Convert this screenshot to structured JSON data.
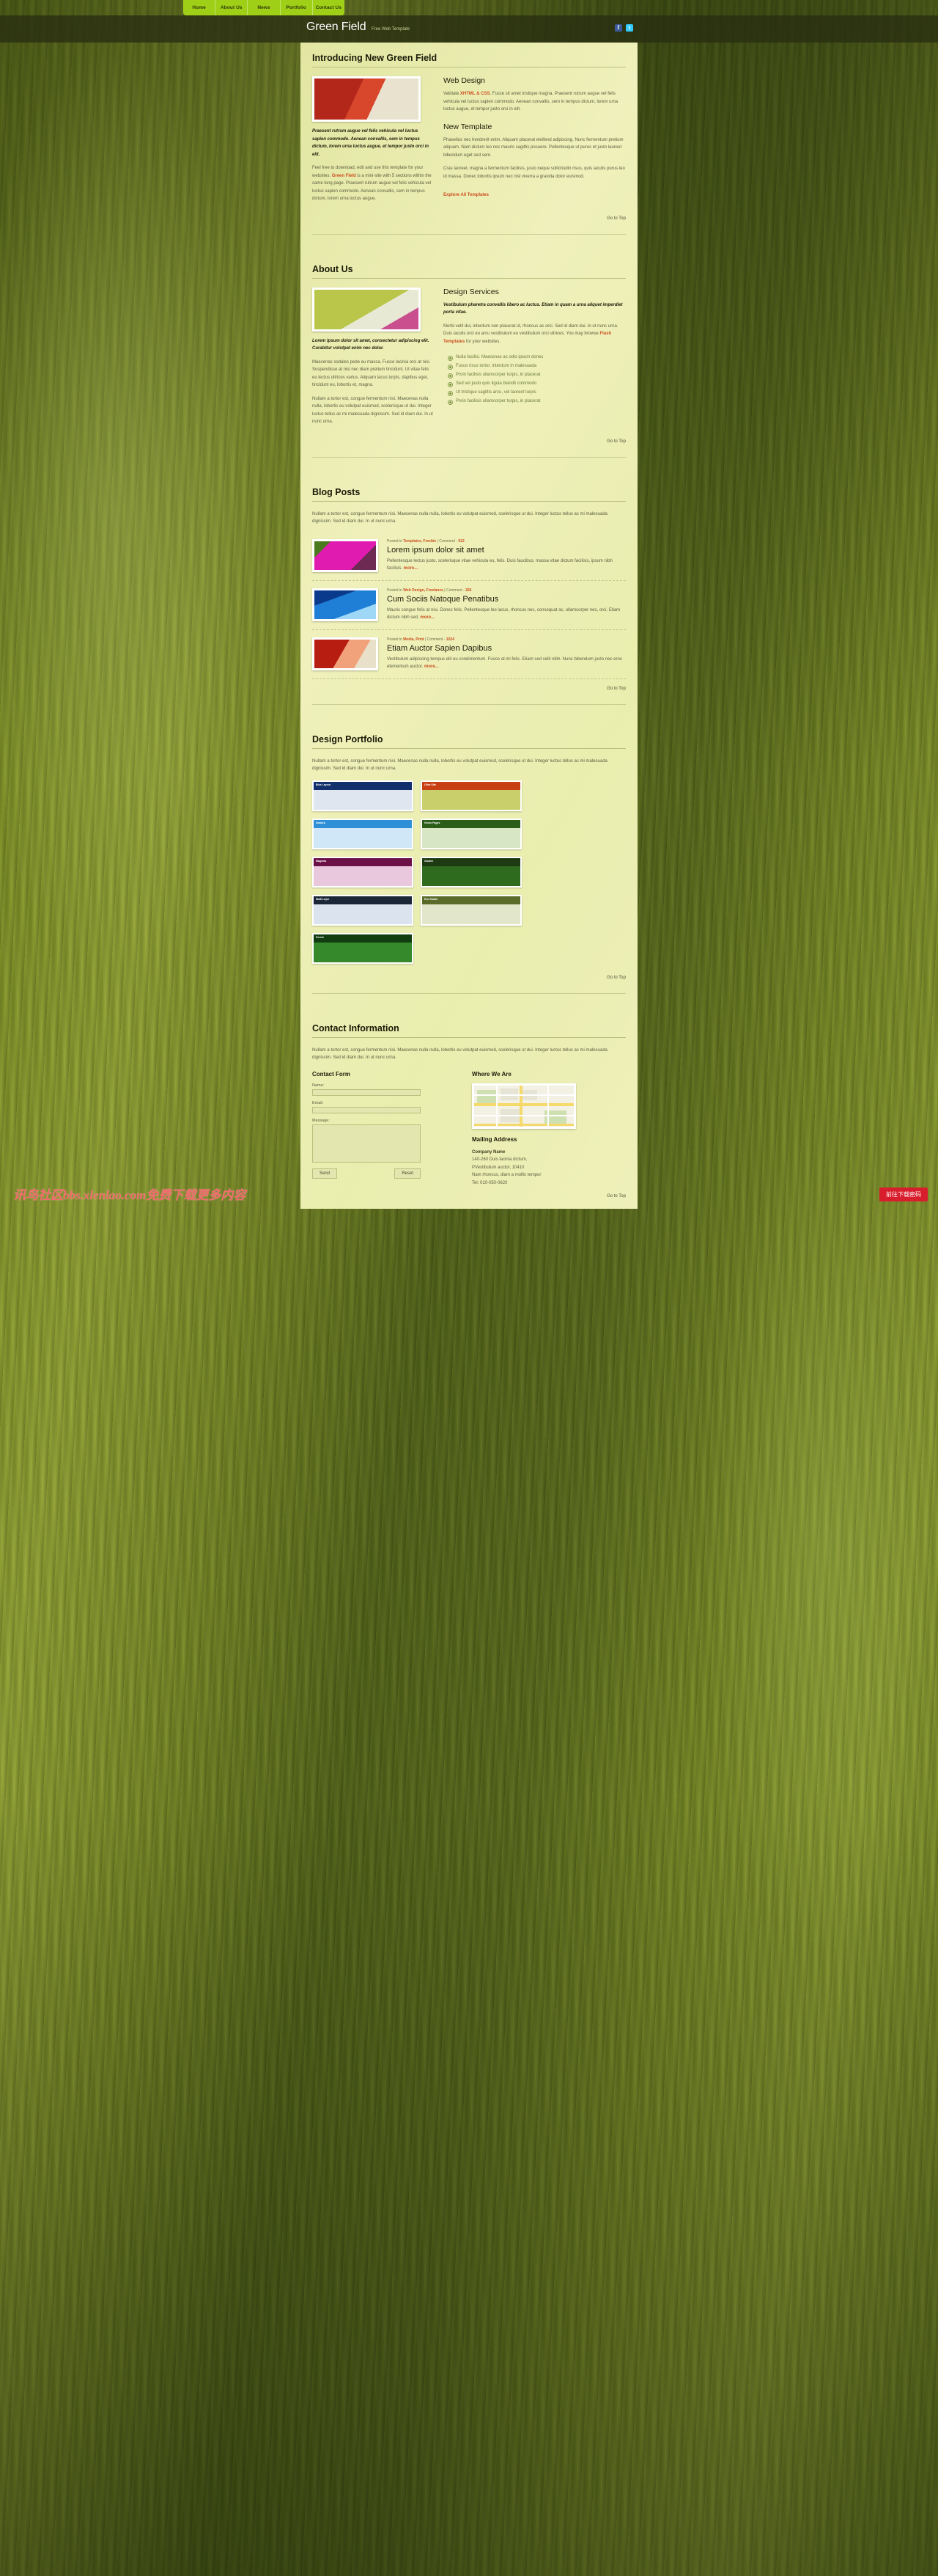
{
  "nav": {
    "items": [
      "Home",
      "About Us",
      "News",
      "Portfolio",
      "Contact Us"
    ]
  },
  "header": {
    "title": "Green Field",
    "tagline": "Free Web Template",
    "social": [
      "facebook-icon",
      "twitter-icon"
    ]
  },
  "go_top": "Go to Top",
  "sections": {
    "intro": {
      "heading": "Introducing New Green Field",
      "left": {
        "caption": "Praesent rutrum augue vel felis vehicula vel luctus sapien commodo. Aenean convallis, sem in tempus dictum, lorem urna luctus augue, et tempor justo orci in elit.",
        "body1": "Feel free to download, edit and use this template for your websites.",
        "link1": "Green Field",
        "body1b": " is a mini-site with 5 sections within the same long page. Praesent rutrum augue vel felis vehicula vel luctus sapien commodo. Aenean convallis, sem in tempus dictum, lorem urna luctus augue."
      },
      "right": {
        "h_web": "Web Design",
        "web_lead": "Validate ",
        "web_link": "XHTML & CSS",
        "web_rest": ". Fusce sit amet tristique magna. Praesent rutrum augue vel felis vehicula vel luctus sapien commodo. Aenean convallis, sem in tempus dictum, lorem urna luctus augue, et tempor justo orci in elit.",
        "h_tpl": "New Template",
        "tpl_p1": "Phasellus nec hendrerit enim. Aliquam placerat eleifend adipiscing. Nunc fermentum pretium aliquam. Nam dictum leo nec mauris sagittis posuere. Pellentesque ut purus et justo laoreet bibendum eget sed sem.",
        "tpl_p2": "Cras laoreet, magna a fermentum facilisis, justo neque sollicitudin risus, quis iaculis purus leo id massa. Donec lobortis ipsum nec nisl viverra a gravida dolor euismod.",
        "tpl_link": "Explore All Templates"
      }
    },
    "about": {
      "heading": "About Us",
      "left": {
        "caption": "Lorem ipsum dolor sit amet, consectetur adipiscing elit. Curabitur volutpat enim nec dolor.",
        "p1": "Maecenas sodales pede eu massa. Fusce lacinia orci at nisi. Suspendisse at nisi nec diam pretium tincidunt. Ut vitae felis eu lectus ultrices varius. Aliquam lacus turpis, dapibus eget, tincidunt eu, lobortis et, magna.",
        "p2": "Nullam a tortor est, congue fermentum nisi. Maecenas nulla nulla, lobortis eu volutpat euismod, scelerisque ut dui. Integer luctus tellus ac mi malesuada dignissim. Sed id diam dui. In ut nunc urna."
      },
      "right": {
        "h_svc": "Design Services",
        "svc_lead": "Vestibulum pharetra convallis libero ac luctus. Etiam in quam a urna aliquet imperdiet porta vitae.",
        "svc_p": "Morbi velit dui, interdum non placerat id, rhoncus ac orci. Sed id diam dui. In ut nunc urna. Duis iaculis orci eu arcu vestibulum eu vestibulum orci ultrices. You may browse ",
        "svc_link": "Flash Templates",
        "svc_p2": " for your websites.",
        "list": [
          "Nulla facilisi. Maecenas ac odio ipsum donec",
          "Fusce risus tortor, interdum in malesuada",
          "Proin facilisis ullamcorper turpis, in placerat",
          "Sed vel justo quis ligula blandit commodo",
          "Ut tristique sagittis arcu, vel laoreet turpis",
          "Proin facilisis ullamcorper turpis, in placerat"
        ]
      }
    },
    "blog": {
      "heading": "Blog Posts",
      "intro": "Nullam a tortor est, congue fermentum nisi. Maecenas nulla nulla, lobortis eu volutpat euismod, scelerisque ut dui. Integer luctus tellus ac mi malesuada dignissim. Sed id diam dui. In ut nunc urna.",
      "posts": [
        {
          "thumb": "orchid-photo",
          "meta_prefix": "Posted in ",
          "meta_cats": "Templates, Freebie",
          "meta_sep": " | Comment - ",
          "meta_count": "512",
          "title": "Lorem ipsum dolor sit amet",
          "excerpt": "Pellentesque lectus justo, scelerisque vitae vehicula eu, felis. Duis faucibus, massa vitae dictum facilisis, ipsum nibh facilisis. ",
          "more": "more..."
        },
        {
          "thumb": "water-photo",
          "meta_prefix": "Posted in ",
          "meta_cats": "Web Design, Freelance",
          "meta_sep": " | Comment - ",
          "meta_count": "256",
          "title": "Cum Sociis Natoque Penatibus",
          "excerpt": "Mauris congue felis at nisi. Donec felis. Pellentesque leo lacus, rhoncus nec, consequat ac, ullamcorper nec, orci. Etiam dictum nibh sed. ",
          "more": "more..."
        },
        {
          "thumb": "sushi-photo",
          "meta_prefix": "Posted in ",
          "meta_cats": "Media, Print",
          "meta_sep": " | Comment - ",
          "meta_count": "1024",
          "title": "Etiam Auctor Sapien Dapibus",
          "excerpt": "Vestibulum adipiscing tempus elit eu condimentum. Fusce at mi felis. Etiam sed velit nibh. Nunc bibendum justo nec eros elementum auctor. ",
          "more": "more..."
        }
      ]
    },
    "portfolio": {
      "heading": "Design Portfolio",
      "intro": "Nullam a tortor est, congue fermentum nisi. Maecenas nulla nulla, lobortis eu volutpat euismod, scelerisque ut dui. Integer luctus tellus ac mi malesuada dignissim. Sed id diam dui. In ut nunc urna.",
      "items": [
        {
          "label": "Blue Layout",
          "bar": "#12306b",
          "body": "#dfe6ef"
        },
        {
          "label": "Olive Site",
          "bar": "#c93f14",
          "body": "#c9cf6a"
        },
        {
          "label": "Seabird",
          "bar": "#2e8fd6",
          "body": "#cfe7f6"
        },
        {
          "label": "Green Pages",
          "bar": "#2a5d18",
          "body": "#d7e6c5"
        },
        {
          "label": "Magenta",
          "bar": "#6b1147",
          "body": "#e9c7dd"
        },
        {
          "label": "Garden",
          "bar": "#1d3a12",
          "body": "#2f6b1f"
        },
        {
          "label": "Multi Layer",
          "bar": "#1b2736",
          "body": "#dbe4ee"
        },
        {
          "label": "Eco Studio",
          "bar": "#5a6b2a",
          "body": "#e2e6cb"
        },
        {
          "label": "Forest",
          "bar": "#123d10",
          "body": "#35892a"
        }
      ]
    },
    "contact": {
      "heading": "Contact Information",
      "intro": "Nullam a tortor est, congue fermentum nisi. Maecenas nulla nulla, lobortis eu volutpat euismod, scelerisque ut dui. Integer luctus tellus ac mi malesuada dignissim. Sed id diam dui. In ut nunc urna.",
      "form": {
        "title": "Contact Form",
        "name_label": "Name:",
        "name_value": "",
        "email_label": "Email:",
        "email_value": "",
        "message_label": "Message:",
        "message_value": "",
        "send": "Send",
        "reset": "Reset"
      },
      "where": {
        "title": "Where We Are",
        "mailing_title": "Mailing Address",
        "company": "Company Name",
        "line1": "140-260 Duis lacinia dictum,",
        "line2": "PVestibulum auctor, 10410",
        "line3": "Nam rhoncus, diam a mollis tempor",
        "line4": "Tel: 010-050-0620"
      }
    }
  },
  "overlay": {
    "watermark": "讯鸟社区bbs.xlenlao.com免费下载更多内容",
    "download_button": "前往下载密码"
  }
}
